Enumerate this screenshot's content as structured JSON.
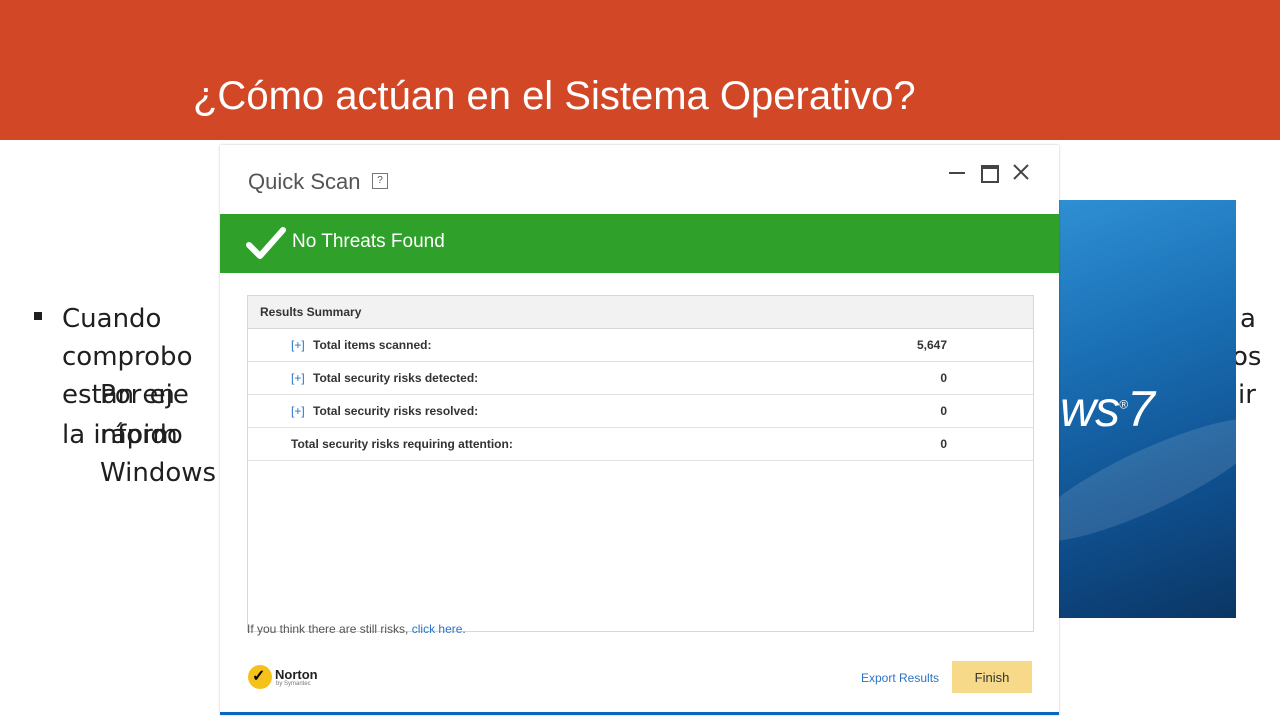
{
  "slide": {
    "title": "¿Cómo actúan en el Sistema Operativo?",
    "bullet_lines": [
      "Cuando",
      "comprobo",
      "estan en",
      "la inform"
    ],
    "sub_lines": [
      "Por eje",
      "rápido",
      "Windows"
    ],
    "right_lines": [
      "a",
      "os",
      "ir"
    ],
    "win7_text": "ws",
    "win7_number": "7",
    "win7_reg": "®"
  },
  "norton": {
    "title": "Quick Scan",
    "help_glyph": "?",
    "status": "No Threats Found",
    "results": {
      "header": "Results Summary",
      "rows": [
        {
          "expand": "[+]",
          "label": "Total items scanned:",
          "value": "5,647"
        },
        {
          "expand": "[+]",
          "label": "Total security risks detected:",
          "value": "0"
        },
        {
          "expand": "[+]",
          "label": "Total security risks resolved:",
          "value": "0"
        },
        {
          "expand": "",
          "label": "Total security risks requiring attention:",
          "value": "0"
        }
      ]
    },
    "footer_prefix": "If you think there are still risks, ",
    "footer_link": "click here",
    "footer_suffix": ".",
    "logo_name": "Norton",
    "logo_sub": "by Symantec",
    "export_label": "Export Results",
    "finish_label": "Finish",
    "colors": {
      "status_green": "#2fa12a",
      "header_red": "#d24726",
      "finish_yellow": "#f6da8a"
    }
  }
}
